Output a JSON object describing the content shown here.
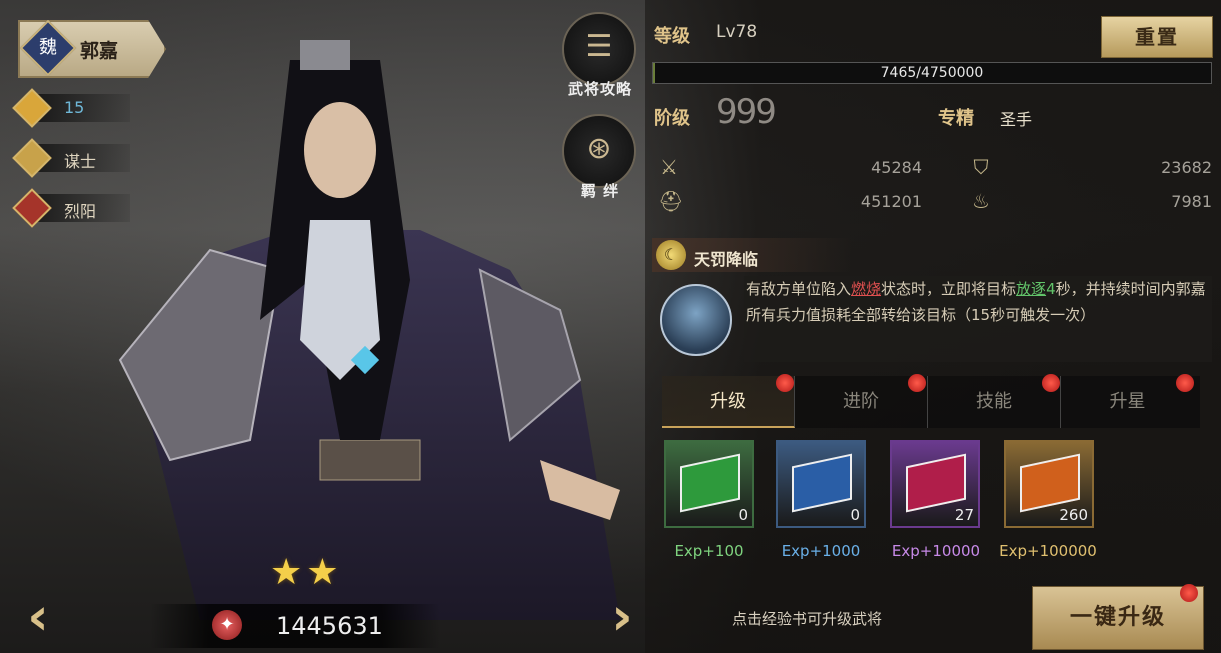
{
  "hero": {
    "faction_glyph": "魏",
    "name": "郭嘉",
    "level_badge": "15",
    "class": "谋士",
    "trait": "烈阳",
    "stars": 2,
    "power": "1445631"
  },
  "side_buttons": {
    "guide_label": "武将攻略",
    "bond_label": "羁 绊"
  },
  "level": {
    "label": "等级",
    "value": "Lv78",
    "reset_label": "重置",
    "exp_text": "7465/4750000",
    "exp_fraction": 0.0016
  },
  "rank": {
    "label": "阶级",
    "marks": "999",
    "spec_label": "专精",
    "spec_value": "圣手"
  },
  "stats": [
    {
      "icon": "sword-icon",
      "value": "45284"
    },
    {
      "icon": "shield-icon",
      "value": "23682"
    },
    {
      "icon": "helmet-icon",
      "value": "451201"
    },
    {
      "icon": "troop-bag-icon",
      "value": "7981"
    }
  ],
  "skill": {
    "name": "天罚降临",
    "desc_part1": "有敌方单位陷入",
    "desc_burn": "燃烧",
    "desc_part2": "状态时，立即将目标",
    "desc_exile": "放逐",
    "desc_num": "4",
    "desc_part3": "秒，并持续时间内郭嘉所有兵力值损耗全部转给该目标（15秒可触发一次）"
  },
  "tabs": [
    "升级",
    "进阶",
    "技能",
    "升星"
  ],
  "books": [
    {
      "count": "0",
      "exp": "Exp+100",
      "color": "#2e9a3c",
      "frame": "#3d6b40",
      "exp_color": "#7fd37f"
    },
    {
      "count": "0",
      "exp": "Exp+1000",
      "color": "#2a5ea6",
      "frame": "#3c5a80",
      "exp_color": "#6ab0e8"
    },
    {
      "count": "27",
      "exp": "Exp+10000",
      "color": "#b01e4a",
      "frame": "#6a3a8e",
      "exp_color": "#c78ae8"
    },
    {
      "count": "260",
      "exp": "Exp+100000",
      "color": "#d0601c",
      "frame": "#8a6a34",
      "exp_color": "#e0c070"
    }
  ],
  "hint": "点击经验书可升级武将",
  "upgrade_button": "一键升级"
}
